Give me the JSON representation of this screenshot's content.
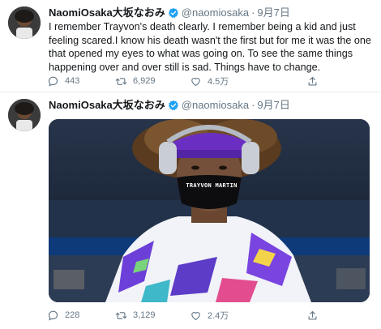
{
  "tweets": [
    {
      "author_name": "NaomiOsaka大坂なおみ",
      "handle": "@naomiosaka",
      "separator": "·",
      "date": "9月7日",
      "text": "I remember Trayvon's death clearly. I remember being a kid and just feeling scared.I know his death wasn't the first but for me it was the one that opened my eyes to what was going on. To see the same things happening over and over still is sad. Things have to change.",
      "replies": "443",
      "retweets": "6,929",
      "likes": "4.5万"
    },
    {
      "author_name": "NaomiOsaka大坂なおみ",
      "handle": "@naomiosaka",
      "separator": "·",
      "date": "9月7日",
      "media": {
        "mask_text": "TRAYVON MARTIN"
      },
      "replies": "228",
      "retweets": "3,129",
      "likes": "2.4万"
    }
  ],
  "colors": {
    "verified": "#1da1f2",
    "secondary_text": "#657786",
    "primary_text": "#14171a"
  },
  "icons": [
    "verified-badge-icon",
    "reply-icon",
    "retweet-icon",
    "like-icon",
    "share-icon"
  ]
}
